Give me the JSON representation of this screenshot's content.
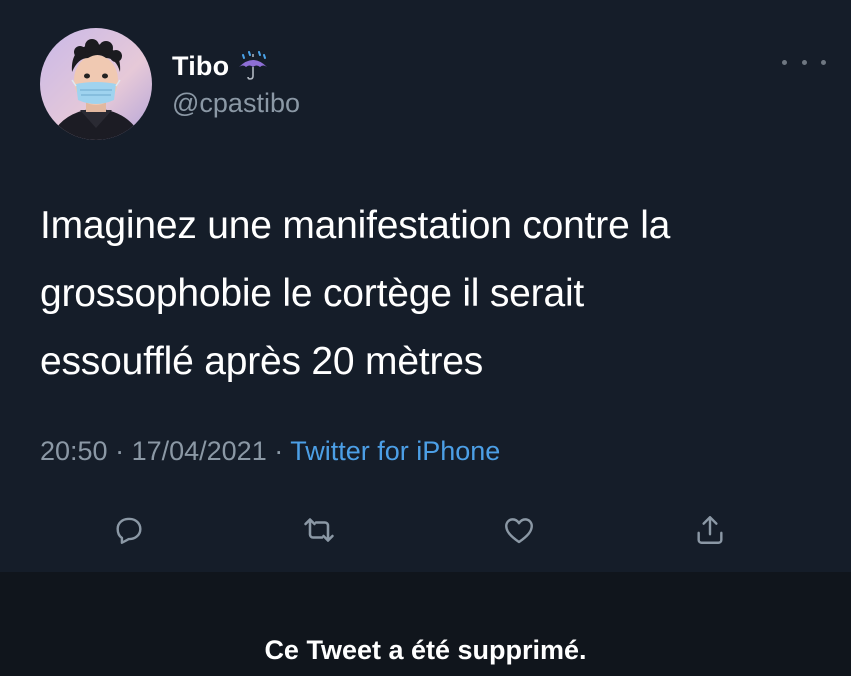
{
  "user": {
    "display_name": "Tibo",
    "name_emoji": "umbrella-with-rain-icon",
    "handle": "@cpastibo"
  },
  "tweet": {
    "lines": [
      "Imaginez une manifestation contre la",
      "grossophobie le cortège il serait",
      "essoufflé après 20 mètres"
    ],
    "time": "20:50",
    "date": "17/04/2021",
    "separator": " · ",
    "source": "Twitter for iPhone"
  },
  "actions": [
    "reply-icon",
    "retweet-icon",
    "like-icon",
    "share-icon"
  ],
  "footer": {
    "deleted_notice": "Ce Tweet a été supprimé."
  },
  "colors": {
    "background": "#151d29",
    "text": "#ffffff",
    "muted": "#8b98a5",
    "link": "#4c9fe6",
    "footer_bg": "#10151c"
  }
}
